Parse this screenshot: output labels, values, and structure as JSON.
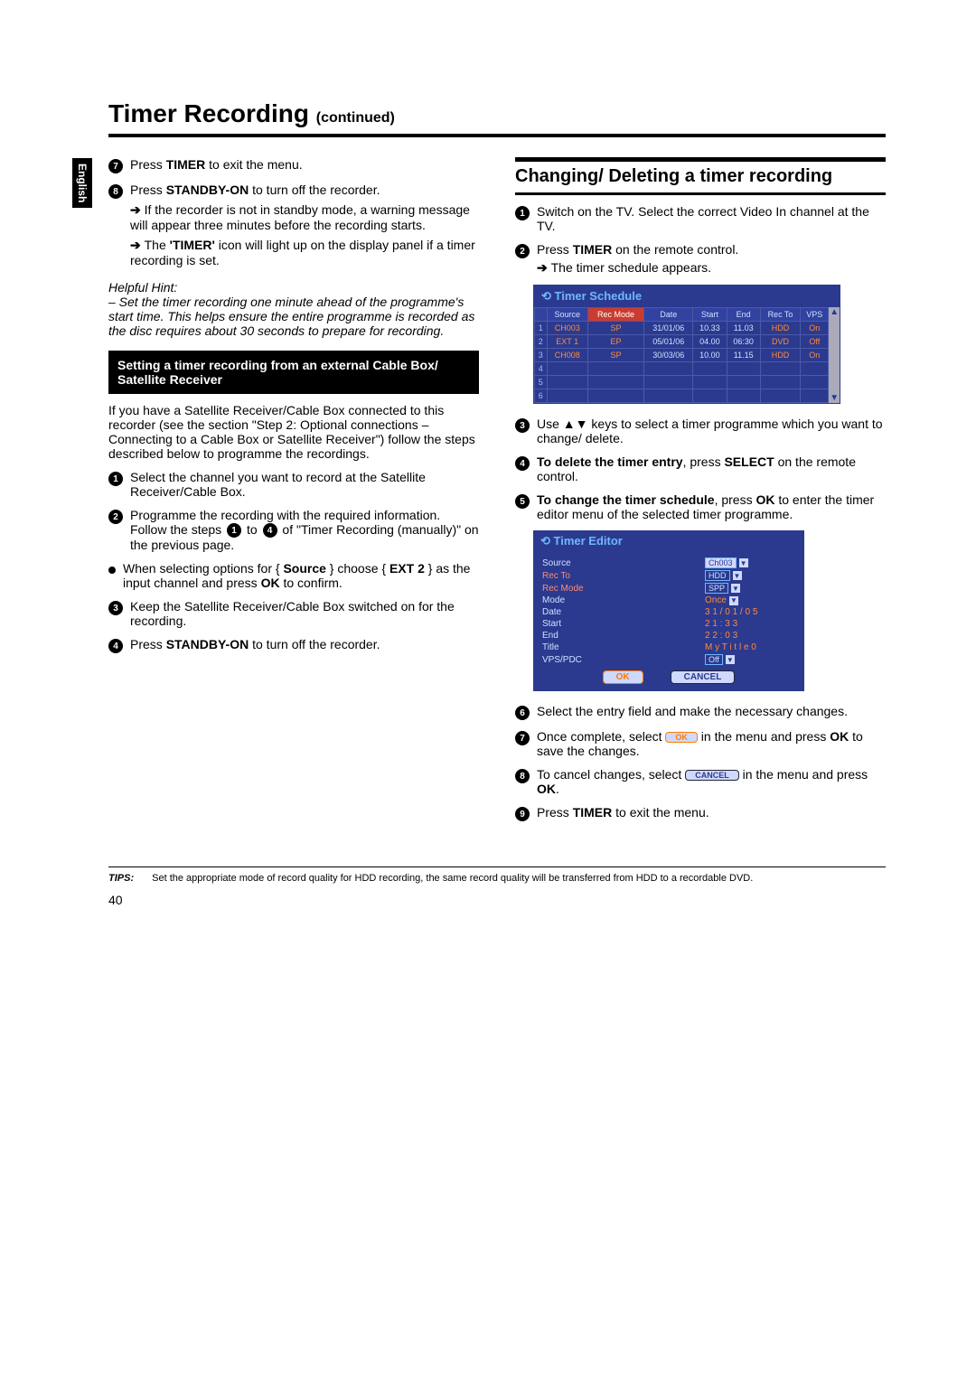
{
  "lang_tab": "English",
  "title_main": "Timer Recording",
  "title_cont": "(continued)",
  "page_number": "40",
  "left": {
    "step7": {
      "n": "7",
      "pre": "Press ",
      "bold": "TIMER",
      "post": " to exit the menu."
    },
    "step8": {
      "n": "8",
      "pre": "Press ",
      "bold": "STANDBY-ON",
      "post": " to turn off the recorder."
    },
    "arrow1": "If the recorder is not in standby mode, a warning message will appear three minutes before the recording starts.",
    "arrow2_pre": "The ",
    "arrow2_bold": "'TIMER'",
    "arrow2_post": " icon will light up on the display panel if a timer recording is set.",
    "hint_label": "Helpful Hint:",
    "hint_text": "– Set the timer recording one minute ahead of the programme's start time. This helps ensure the entire programme is recorded as the disc requires about 30 seconds to prepare for recording.",
    "blackbox": "Setting a timer recording from an external Cable Box/ Satellite Receiver",
    "intro": "If you have a Satellite Receiver/Cable Box connected to this recorder (see the section \"Step 2: Optional connections – Connecting to a Cable Box or Satellite Receiver\") follow the steps described below to programme the recordings.",
    "s1": {
      "n": "1",
      "text": "Select the channel you want to record at the Satellite Receiver/Cable Box."
    },
    "s2": {
      "n": "2",
      "pre": "Programme the recording with the required information. Follow the steps ",
      "mid": " to ",
      "post": " of \"Timer Recording (manually)\" on the previous page.",
      "b1": "1",
      "b4": "4"
    },
    "s2b_pre": "When selecting options for { ",
    "s2b_b1": "Source",
    "s2b_mid": " } choose { ",
    "s2b_b2": "EXT 2",
    "s2b_mid2": " } as the input channel and press ",
    "s2b_b3": "OK",
    "s2b_post": " to confirm.",
    "s3": {
      "n": "3",
      "text": "Keep the Satellite Receiver/Cable Box switched on for the recording."
    },
    "s4": {
      "n": "4",
      "pre": "Press ",
      "bold": "STANDBY-ON",
      "post": " to turn off the recorder."
    }
  },
  "right": {
    "heading": "Changing/ Deleting a timer recording",
    "r1": {
      "n": "1",
      "text": "Switch on the TV. Select the correct Video In channel at the TV."
    },
    "r2": {
      "n": "2",
      "pre": "Press ",
      "bold": "TIMER",
      "post": " on the remote control."
    },
    "r2arrow": "The timer schedule appears.",
    "r3": {
      "n": "3",
      "pre": "Use ",
      "sym": "▲▼",
      "post": " keys to select a timer programme which you want to change/ delete."
    },
    "r4": {
      "n": "4",
      "b1": "To delete the timer entry",
      "mid": ", press ",
      "b2": "SELECT",
      "post": " on the remote control."
    },
    "r5": {
      "n": "5",
      "b1": "To change the timer schedule",
      "mid": ", press ",
      "b2": "OK",
      "post": " to enter the timer editor menu of the selected timer programme."
    },
    "r6": {
      "n": "6",
      "text": "Select the entry field and make the necessary changes."
    },
    "r7": {
      "n": "7",
      "pre": "Once complete, select ",
      "btn": "OK",
      "mid": " in the menu and press ",
      "bold": "OK",
      "post": " to save the changes."
    },
    "r8": {
      "n": "8",
      "pre": "To cancel changes, select ",
      "btn": "CANCEL",
      "mid": " in the menu and press ",
      "bold": "OK",
      "post": "."
    },
    "r9": {
      "n": "9",
      "pre": "Press ",
      "bold": "TIMER",
      "post": " to exit the menu."
    }
  },
  "schedule": {
    "title": "Timer Schedule",
    "headers": [
      "",
      "Source",
      "Rec Mode",
      "Date",
      "Start",
      "End",
      "Rec To",
      "VPS"
    ],
    "rows": [
      {
        "n": "1",
        "source": "CH003",
        "mode": "SP",
        "date": "31/01/06",
        "start": "10.33",
        "end": "11.03",
        "recto": "HDD",
        "vps": "On"
      },
      {
        "n": "2",
        "source": "EXT 1",
        "mode": "EP",
        "date": "05/01/06",
        "start": "04.00",
        "end": "06:30",
        "recto": "DVD",
        "vps": "Off"
      },
      {
        "n": "3",
        "source": "CH008",
        "mode": "SP",
        "date": "30/03/06",
        "start": "10.00",
        "end": "11.15",
        "recto": "HDD",
        "vps": "On"
      },
      {
        "n": "4"
      },
      {
        "n": "5"
      },
      {
        "n": "6"
      }
    ]
  },
  "editor": {
    "title": "Timer Editor",
    "rows": [
      {
        "label": "Source",
        "value": "Ch003",
        "box": "inv",
        "dd": true
      },
      {
        "label": "Rec To",
        "value": "HDD",
        "box": "line",
        "dd": true,
        "red": true
      },
      {
        "label": "Rec Mode",
        "value": "SPP",
        "box": "line",
        "dd": true,
        "red": true
      },
      {
        "label": "Mode",
        "value": "Once",
        "orange": true,
        "dd": true
      },
      {
        "label": "Date",
        "value": "3 1 / 0 1 / 0 5",
        "orange": true
      },
      {
        "label": "Start",
        "value": "2 1 : 3 3",
        "orange": true
      },
      {
        "label": "End",
        "value": "2 2 : 0 3",
        "orange": true
      },
      {
        "label": "Title",
        "value": "M y T i t l e 0",
        "orange": true
      },
      {
        "label": "VPS/PDC",
        "value": "Off",
        "box": "line",
        "dd": true
      }
    ],
    "ok": "OK",
    "cancel": "CANCEL"
  },
  "tips": {
    "label": "TIPS:",
    "text": "Set the appropriate mode of record quality for HDD recording, the same record quality will be transferred from HDD to a recordable DVD."
  }
}
